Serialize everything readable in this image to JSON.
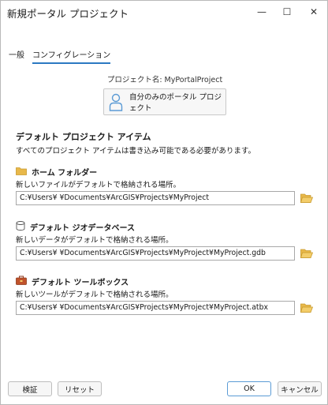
{
  "window": {
    "title": "新規ポータル プロジェクト",
    "minimize_glyph": "—",
    "maximize_glyph": "☐",
    "close_glyph": "✕"
  },
  "tabs": [
    {
      "label": "一般",
      "active": false
    },
    {
      "label": "コンフィグレーション",
      "active": true
    }
  ],
  "project": {
    "name_label": "プロジェクト名: MyPortalProject",
    "location_button": "自分のみのポータル プロジェクト"
  },
  "defaults": {
    "title": "デフォルト プロジェクト アイテム",
    "description": "すべてのプロジェクト アイテムは書き込み可能である必要があります。",
    "home_folder": {
      "label": "ホーム フォルダー",
      "description": "新しいファイルがデフォルトで格納される場所。",
      "value": "C:¥Users¥      ¥Documents¥ArcGIS¥Projects¥MyProject"
    },
    "geodatabase": {
      "label": "デフォルト ジオデータベース",
      "description": "新しいデータがデフォルトで格納される場所。",
      "value": "C:¥Users¥      ¥Documents¥ArcGIS¥Projects¥MyProject¥MyProject.gdb"
    },
    "toolbox": {
      "label": "デフォルト ツールボックス",
      "description": "新しいツールがデフォルトで格納される場所。",
      "value": "C:¥Users¥      ¥Documents¥ArcGIS¥Projects¥MyProject¥MyProject.atbx"
    }
  },
  "buttons": {
    "validate": "検証",
    "reset": "リセット",
    "ok": "OK",
    "cancel": "キャンセル"
  },
  "colors": {
    "accent": "#2b79c2",
    "folder": "#e8b84a",
    "toolbox": "#c0532b",
    "person": "#5b9bd5"
  }
}
